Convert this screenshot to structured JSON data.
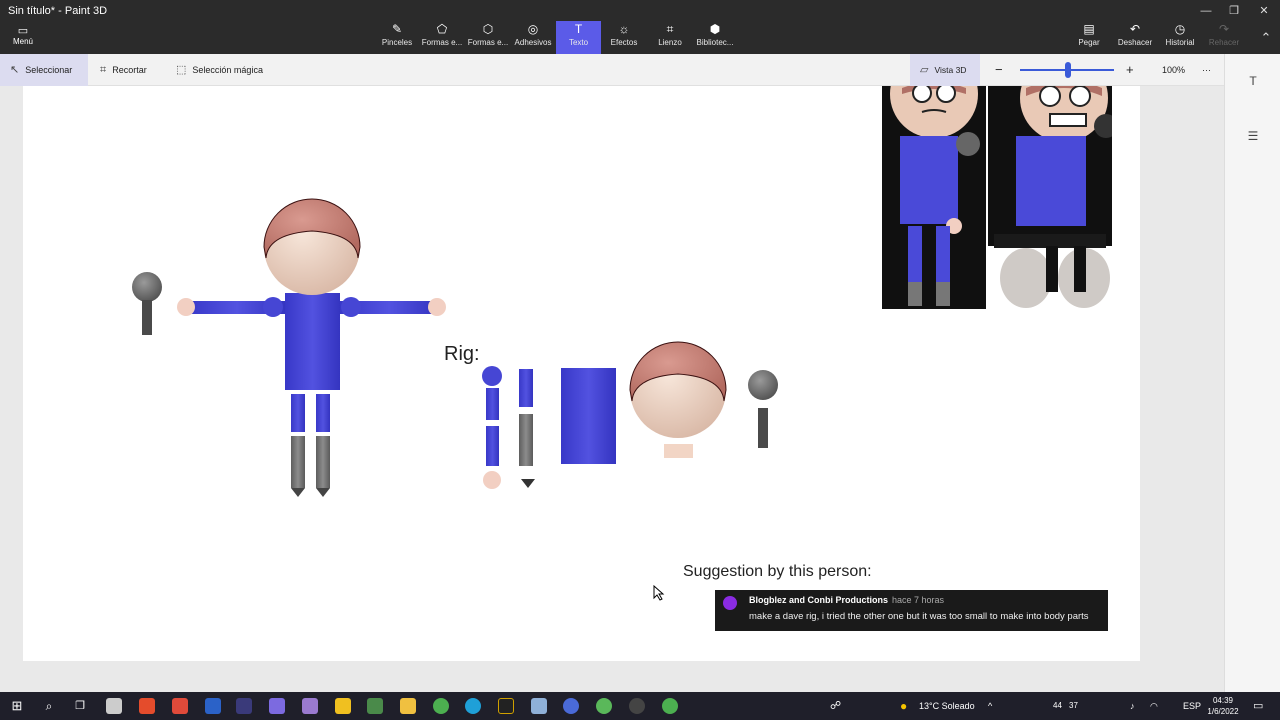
{
  "window": {
    "title": "Sin título* - Paint 3D"
  },
  "ribbon": {
    "menu_label": "Menú",
    "tools": [
      {
        "label": "Pinceles",
        "icon": "brush-icon"
      },
      {
        "label": "Formas e...",
        "icon": "2d-shapes-icon"
      },
      {
        "label": "Formas e...",
        "icon": "3d-shapes-icon"
      },
      {
        "label": "Adhesivos",
        "icon": "stickers-icon"
      },
      {
        "label": "Texto",
        "icon": "text-icon"
      },
      {
        "label": "Efectos",
        "icon": "effects-icon"
      },
      {
        "label": "Lienzo",
        "icon": "canvas-icon"
      },
      {
        "label": "Bibliotec...",
        "icon": "library-icon"
      }
    ],
    "active_tool": "Texto",
    "right_tools": [
      {
        "label": "Pegar",
        "icon": "paste-icon"
      },
      {
        "label": "Deshacer",
        "icon": "undo-icon"
      },
      {
        "label": "Historial",
        "icon": "history-icon"
      },
      {
        "label": "Rehacer",
        "icon": "redo-icon"
      }
    ]
  },
  "toolbar": {
    "select_label": "Seleccionar",
    "crop_label": "Recortar",
    "magic_label": "Selección mágica",
    "view3d_label": "Vista 3D",
    "zoom_label": "100%",
    "zoom_level": 0.5
  },
  "canvas": {
    "rig_label": "Rig:",
    "suggestion_label": "Suggestion by this person:",
    "comment": {
      "author": "Blogblez and Conbi Productions",
      "time": "hace 7 horas",
      "text": "make a dave rig, i tried the other one but it was too small to make into body parts"
    }
  },
  "taskbar": {
    "weather": "13°C  Soleado",
    "lang": "ESP",
    "time": "04:39",
    "date": "1/6/2022",
    "tray_num_a": "44",
    "tray_num_b": "37"
  },
  "colors": {
    "accent": "#5b5be8",
    "body_blue": "#4747d6",
    "skin": "#f0d6c4",
    "hair": "#c98176",
    "grey": "#808080"
  }
}
